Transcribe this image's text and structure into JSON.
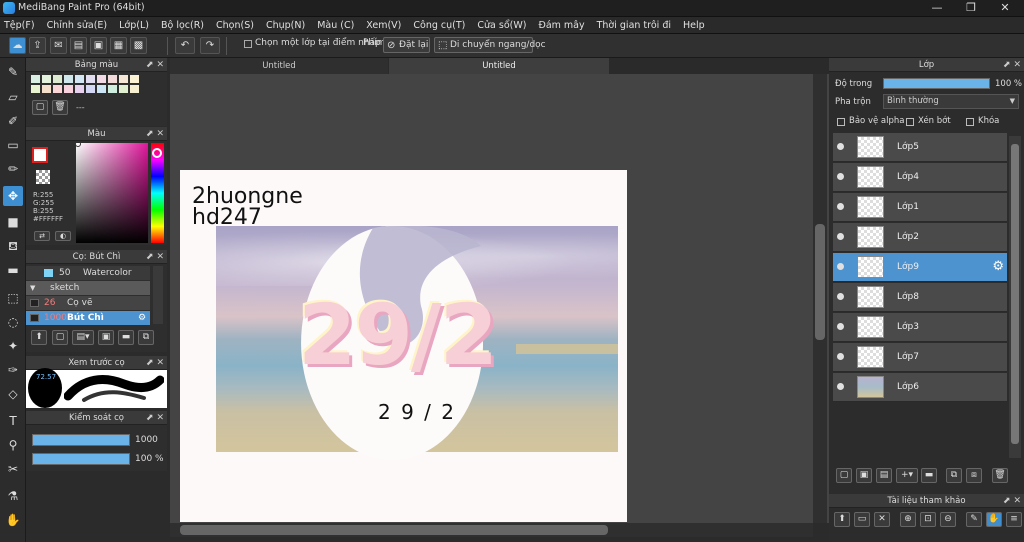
{
  "app": {
    "title": "MediBang Paint Pro (64bit)",
    "window_controls": {
      "minimize": "—",
      "restore": "❐",
      "close": "✕"
    }
  },
  "menu": [
    "Tệp(F)",
    "Chỉnh sửa(E)",
    "Lớp(L)",
    "Bộ lọc(R)",
    "Chọn(S)",
    "Chụp(N)",
    "Màu (C)",
    "Xem(V)",
    "Công cụ(T)",
    "Cửa sổ(W)",
    "Đám mây",
    "Thời gian trôi đi",
    "Help"
  ],
  "toolbar": {
    "snap_label": "Chọn một lớp tại điểm nhấp",
    "phim_label": "Phím",
    "reset_label": "Đặt lại",
    "move_label": "Di chuyển ngang/dọc"
  },
  "palette_panel": {
    "title": "Bảng màu",
    "value": "---"
  },
  "color_panel": {
    "title": "Màu",
    "r": "R:255",
    "g": "G:255",
    "b": "B:255",
    "hex": "#FFFFFF",
    "colors": {
      "fg": "#ffffff",
      "hue": "#e0169c"
    }
  },
  "brush_panel": {
    "title": "Cọ: Bút Chì",
    "brushes": [
      {
        "size": "50",
        "name": "Watercolor"
      },
      {
        "size": "",
        "name": "sketch"
      },
      {
        "size": "26",
        "name": "Cọ vẽ"
      },
      {
        "size": "1000",
        "name": "Bút Chì"
      }
    ]
  },
  "preview_panel": {
    "title": "Xem trước cọ",
    "value": "72.57"
  },
  "control_panel": {
    "title": "Kiểm soát cọ",
    "size": "1000",
    "opacity": "100 %",
    "size_fraction": 1.0,
    "opacity_fraction": 1.0
  },
  "tabs": [
    "Untitled",
    "Untitled"
  ],
  "canvas": {
    "watermark_line1": "2huongne",
    "watermark_line2": "hd247",
    "big_date": "29/2",
    "small_date": "2 9 / 2"
  },
  "layer_panel": {
    "title": "Lớp",
    "opacity_label": "Độ trong",
    "opacity_value": "100 %",
    "opacity_fraction": 1.0,
    "blend_label": "Pha trộn",
    "blend_value": "Bình thường",
    "protect_alpha": "Bảo vệ alpha",
    "clipping": "Xén bớt",
    "lock": "Khóa",
    "layers": [
      "Lớp5",
      "Lớp4",
      "Lớp1",
      "Lớp2",
      "Lớp9",
      "Lớp8",
      "Lớp3",
      "Lớp7",
      "Lớp6"
    ],
    "selected_layer": "Lớp9"
  },
  "reference_panel": {
    "title": "Tài liệu tham khảo"
  },
  "colors": {
    "accent": "#4d93cf",
    "bg": "#2b2b2b"
  }
}
